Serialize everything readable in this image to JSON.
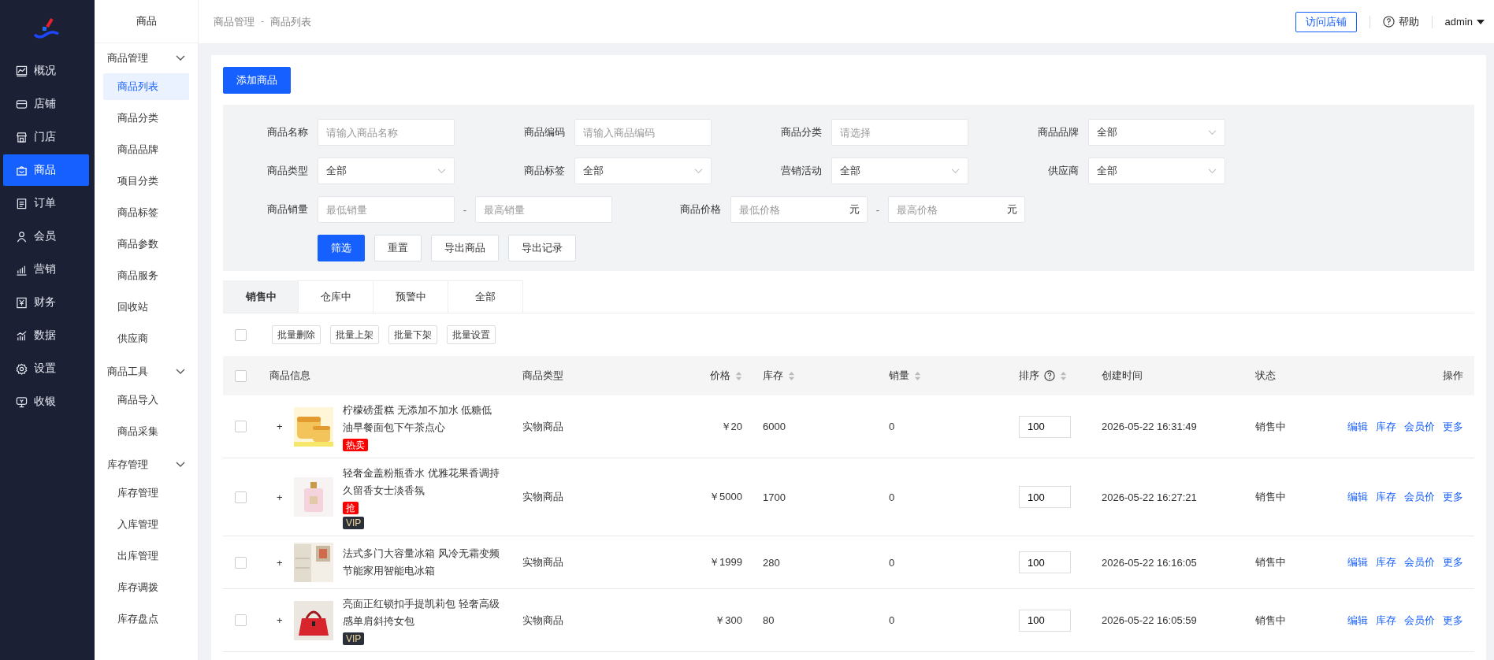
{
  "nav": [
    {
      "label": "概况",
      "selected": false
    },
    {
      "label": "店铺",
      "selected": false
    },
    {
      "label": "门店",
      "selected": false
    },
    {
      "label": "商品",
      "selected": true
    },
    {
      "label": "订单",
      "selected": false
    },
    {
      "label": "会员",
      "selected": false
    },
    {
      "label": "营销",
      "selected": false
    },
    {
      "label": "财务",
      "selected": false
    },
    {
      "label": "数据",
      "selected": false
    },
    {
      "label": "设置",
      "selected": false
    },
    {
      "label": "收银",
      "selected": false
    }
  ],
  "submenu": {
    "title": "商品",
    "groups": [
      {
        "label": "商品管理",
        "expanded": true,
        "items": [
          {
            "label": "商品列表",
            "selected": true
          },
          {
            "label": "商品分类",
            "selected": false
          },
          {
            "label": "商品品牌",
            "selected": false
          },
          {
            "label": "项目分类",
            "selected": false
          },
          {
            "label": "商品标签",
            "selected": false
          },
          {
            "label": "商品参数",
            "selected": false
          },
          {
            "label": "商品服务",
            "selected": false
          },
          {
            "label": "回收站",
            "selected": false
          },
          {
            "label": "供应商",
            "selected": false
          }
        ]
      },
      {
        "label": "商品工具",
        "expanded": true,
        "items": [
          {
            "label": "商品导入",
            "selected": false
          },
          {
            "label": "商品采集",
            "selected": false
          }
        ]
      },
      {
        "label": "库存管理",
        "expanded": true,
        "items": [
          {
            "label": "库存管理",
            "selected": false
          },
          {
            "label": "入库管理",
            "selected": false
          },
          {
            "label": "出库管理",
            "selected": false
          },
          {
            "label": "库存调拨",
            "selected": false
          },
          {
            "label": "库存盘点",
            "selected": false
          }
        ]
      }
    ]
  },
  "breadcrumb": [
    "商品管理",
    "-",
    "商品列表"
  ],
  "topbar": {
    "visit": "访问店铺",
    "help": "帮助",
    "user": "admin"
  },
  "add_button": "添加商品",
  "filters": [
    [
      {
        "kind": "input",
        "label": "商品名称",
        "placeholder": "请输入商品名称"
      },
      {
        "kind": "input",
        "label": "商品编码",
        "placeholder": "请输入商品编码"
      },
      {
        "kind": "input",
        "label": "商品分类",
        "placeholder": "请选择"
      },
      {
        "kind": "select",
        "label": "商品品牌",
        "value": "全部"
      }
    ],
    [
      {
        "kind": "select",
        "label": "商品类型",
        "value": "全部"
      },
      {
        "kind": "select",
        "label": "商品标签",
        "value": "全部"
      },
      {
        "kind": "select",
        "label": "营销活动",
        "value": "全部"
      },
      {
        "kind": "select",
        "label": "供应商",
        "value": "全部"
      }
    ],
    [
      {
        "kind": "range",
        "label": "商品销量",
        "min": {
          "placeholder": "最低销量"
        },
        "separator": "-",
        "max": {
          "placeholder": "最高销量"
        }
      },
      {
        "kind": "range",
        "label": "商品价格",
        "min": {
          "placeholder": "最低价格",
          "unit": "元"
        },
        "separator": "-",
        "max": {
          "placeholder": "最高价格",
          "unit": "元"
        }
      }
    ]
  ],
  "filter_buttons": [
    {
      "label": "筛选",
      "primary": true
    },
    {
      "label": "重置",
      "primary": false
    },
    {
      "label": "导出商品",
      "primary": false
    },
    {
      "label": "导出记录",
      "primary": false
    }
  ],
  "tabs": [
    {
      "label": "销售中",
      "selected": true
    },
    {
      "label": "仓库中",
      "selected": false
    },
    {
      "label": "预警中",
      "selected": false
    },
    {
      "label": "全部",
      "selected": false
    }
  ],
  "batch": {
    "checked": false,
    "buttons": [
      "批量删除",
      "批量上架",
      "批量下架",
      "批量设置"
    ]
  },
  "table": {
    "header_checked": false,
    "columns": [
      {
        "label": "商品信息",
        "sortable": false,
        "help": false
      },
      {
        "label": "商品类型",
        "sortable": false,
        "help": false
      },
      {
        "label": "价格",
        "sortable": true,
        "help": false
      },
      {
        "label": "库存",
        "sortable": true,
        "help": false
      },
      {
        "label": "销量",
        "sortable": true,
        "help": false
      },
      {
        "label": "排序",
        "sortable": true,
        "help": true
      },
      {
        "label": "创建时间",
        "sortable": false,
        "help": false
      },
      {
        "label": "状态",
        "sortable": false,
        "help": false
      },
      {
        "label": "操作",
        "sortable": false,
        "help": false
      }
    ],
    "rows": [
      {
        "checked": false,
        "expand": "+",
        "image": {
          "kind": "picture"
        },
        "name": "柠檬磅蛋糕 无添加不加水 低糖低油早餐面包下午茶点心",
        "tags": [
          {
            "kind": "promo",
            "label": "热卖"
          }
        ],
        "type": "实物商品",
        "price": "￥20",
        "stock": "6000",
        "sales": "0",
        "sort": "100",
        "created": "2026-05-22 16:31:49",
        "status": "销售中",
        "actions": [
          "编辑",
          "库存",
          "会员价",
          "更多"
        ]
      },
      {
        "checked": false,
        "expand": "+",
        "image": {
          "kind": "picture"
        },
        "name": "轻奢金盖粉瓶香水 优雅花果香调持久留香女士淡香氛",
        "tags": [
          {
            "kind": "promo",
            "label": "抢"
          },
          {
            "kind": "vip",
            "label": "VIP"
          }
        ],
        "type": "实物商品",
        "price": "￥5000",
        "stock": "1700",
        "sales": "0",
        "sort": "100",
        "created": "2026-05-22 16:27:21",
        "status": "销售中",
        "actions": [
          "编辑",
          "库存",
          "会员价",
          "更多"
        ]
      },
      {
        "checked": false,
        "expand": "+",
        "image": {
          "kind": "picture"
        },
        "name": "法式多门大容量冰箱 风冷无霜变频节能家用智能电冰箱",
        "tags": [],
        "type": "实物商品",
        "price": "￥1999",
        "stock": "280",
        "sales": "0",
        "sort": "100",
        "created": "2026-05-22 16:16:05",
        "status": "销售中",
        "actions": [
          "编辑",
          "库存",
          "会员价",
          "更多"
        ]
      },
      {
        "checked": false,
        "expand": "+",
        "image": {
          "kind": "picture"
        },
        "name": "亮面正红锁扣手提凯莉包 轻奢高级感单肩斜挎女包",
        "tags": [
          {
            "kind": "vip",
            "label": "VIP"
          }
        ],
        "type": "实物商品",
        "price": "￥300",
        "stock": "80",
        "sales": "0",
        "sort": "100",
        "created": "2026-05-22 16:05:59",
        "status": "销售中",
        "actions": [
          "编辑",
          "库存",
          "会员价",
          "更多"
        ]
      }
    ]
  }
}
